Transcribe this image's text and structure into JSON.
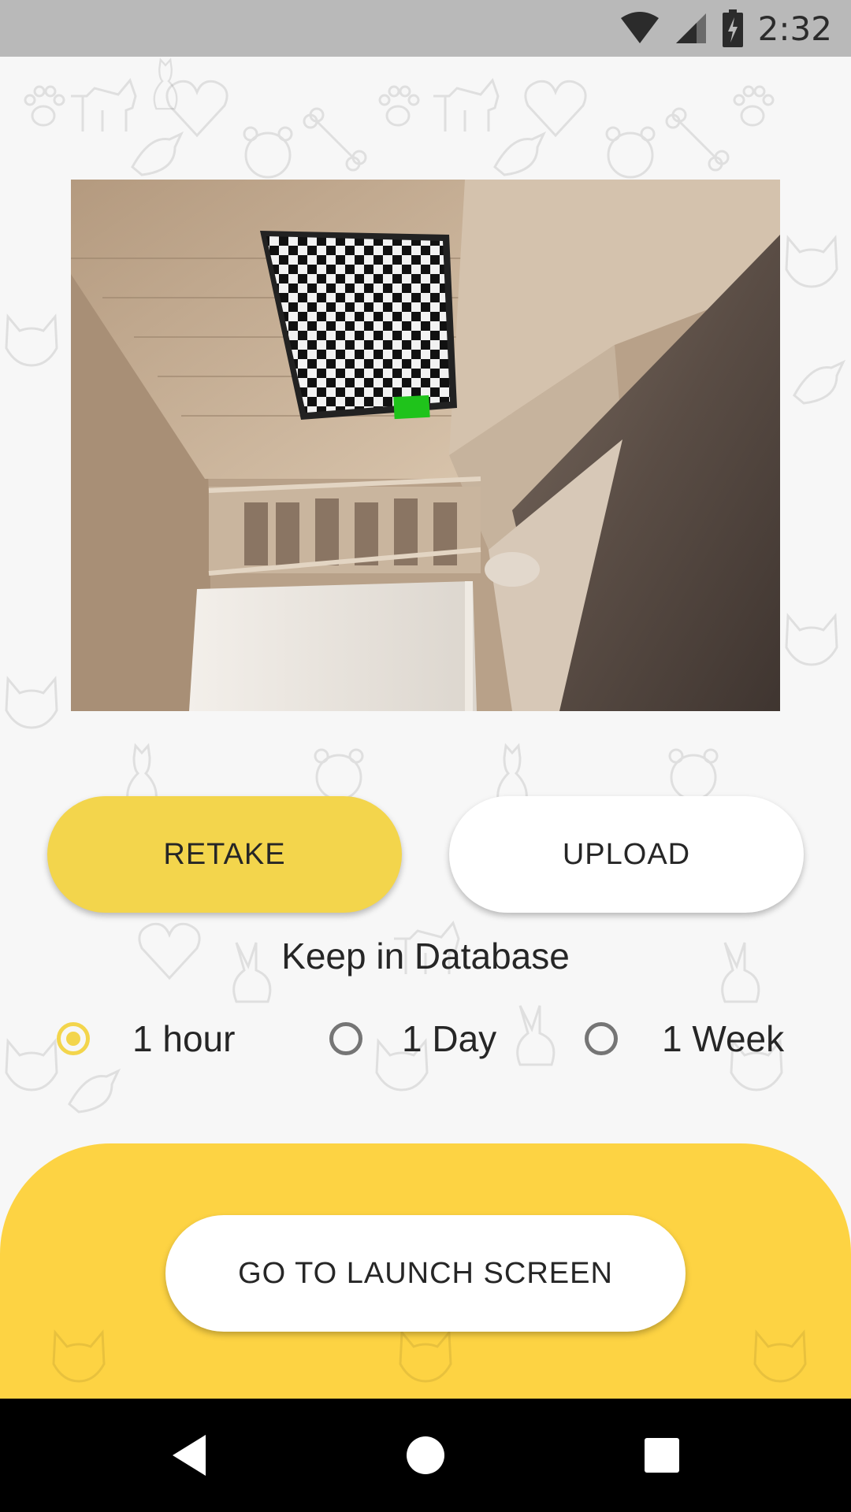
{
  "status_bar": {
    "time": "2:32",
    "icons": [
      "wifi-icon",
      "cell-signal-icon",
      "battery-charging-icon"
    ]
  },
  "photo": {
    "description_icon": "camera-photo"
  },
  "actions": {
    "retake_label": "RETAKE",
    "upload_label": "UPLOAD"
  },
  "keep": {
    "title": "Keep in Database",
    "options": [
      {
        "label": "1 hour",
        "selected": true
      },
      {
        "label": "1 Day",
        "selected": false
      },
      {
        "label": "1 Week",
        "selected": false
      }
    ]
  },
  "bottom": {
    "launch_label": "GO TO LAUNCH SCREEN"
  },
  "nav": {
    "icons": [
      "back-icon",
      "home-icon",
      "recents-icon"
    ]
  },
  "colors": {
    "accent_yellow": "#f3d54c",
    "panel_yellow": "#fdd343",
    "status_bar": "#b9b9b9"
  }
}
